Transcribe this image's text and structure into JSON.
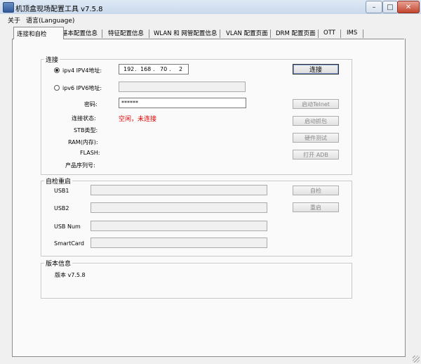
{
  "window": {
    "title": "机顶盒现场配置工具 v7.5.8"
  },
  "menu": {
    "items": [
      "关于",
      "语言(Language)"
    ]
  },
  "tabs": [
    "连接和自检",
    "基本配置信息",
    "特征配置信息",
    "WLAN 和 网管配置信息",
    "VLAN 配置页面",
    "DRM 配置页面",
    "OTT",
    "IMS"
  ],
  "active_tab": 0,
  "connection": {
    "legend": "连接",
    "ipv4_label": "ipv4  IPV4地址:",
    "ipv4_selected": true,
    "ipv4_octets": [
      "192",
      "168",
      "70",
      "2"
    ],
    "ipv6_label": "ipv6  IPV6地址:",
    "ipv6_value": "",
    "password_label": "密码:",
    "password_value": "******",
    "status_label": "连接状态:",
    "status_value": "空闲，未连接",
    "status_color": "#e00000",
    "stb_type_label": "STB类型:",
    "ram_label": "RAM(内存):",
    "flash_label": "FLASH:",
    "serial_label": "产品序列号:",
    "buttons": {
      "connect": "连接",
      "telnet": "启动Telnet",
      "capture": "启动抓包",
      "hw_test": "硬件测试",
      "adb": "打开 ADB"
    }
  },
  "selftest": {
    "legend": "自检重启",
    "usb1_label": "USB1",
    "usb2_label": "USB2",
    "usb_num_label": "USB Num",
    "smartcard_label": "SmartCard",
    "check_button": "自检",
    "reboot_button": "重启"
  },
  "version": {
    "legend": "版本信息",
    "text": "版本 v7.5.8"
  }
}
